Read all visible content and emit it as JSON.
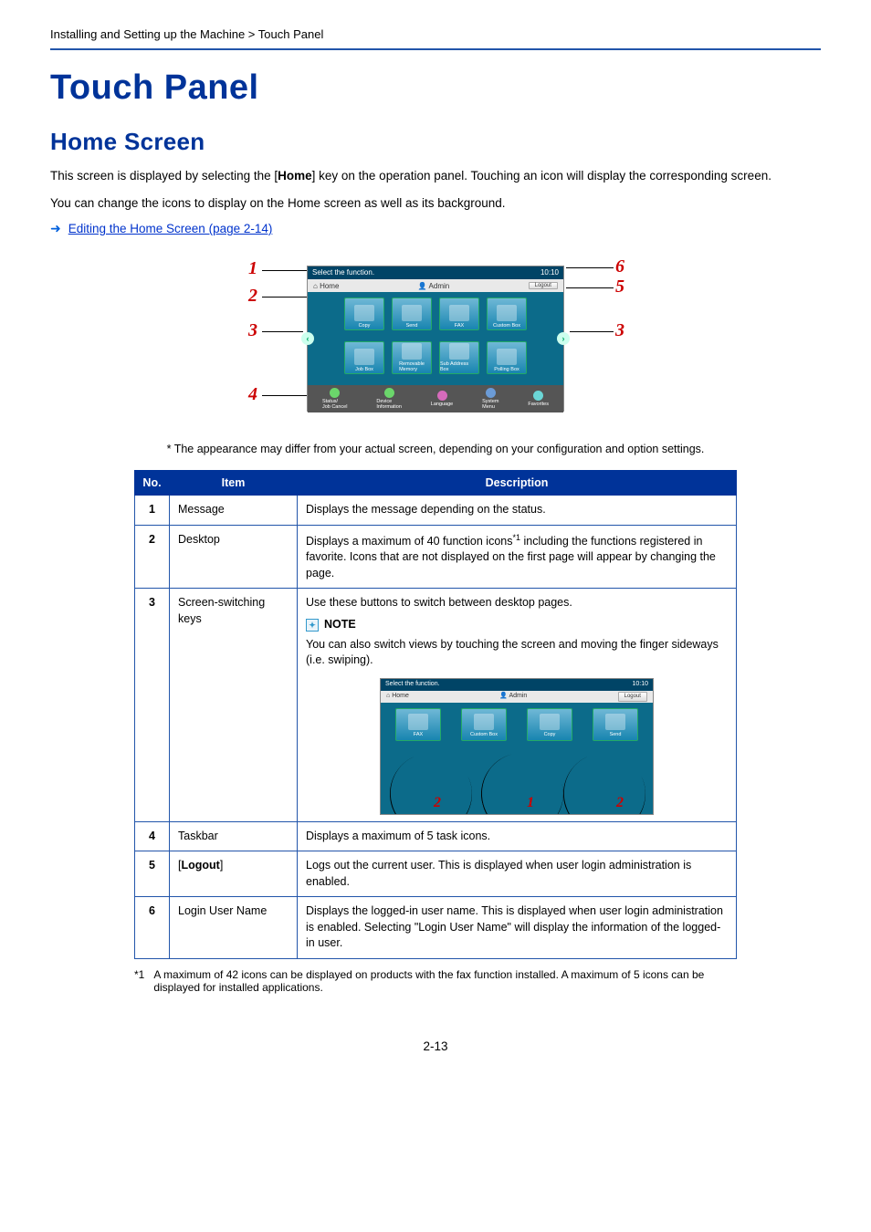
{
  "breadcrumb": "Installing and Setting up the Machine > Touch Panel",
  "title_main": "Touch Panel",
  "title_section": "Home Screen",
  "para1_prefix": "This screen is displayed by selecting the [",
  "para1_bold": "Home",
  "para1_suffix": "] key on the operation panel. Touching an icon will display the corresponding screen.",
  "para2": "You can change the icons to display on the Home screen as well as its background.",
  "link_text": "Editing the Home Screen (page 2-14)",
  "callouts": {
    "c1": "1",
    "c2": "2",
    "c3": "3",
    "c3r": "3",
    "c4": "4",
    "c5": "5",
    "c6": "6"
  },
  "screen": {
    "top_msg": "Select the function.",
    "time": "10:10",
    "home": "Home",
    "admin": "Admin",
    "logout": "Logout",
    "row1": [
      "Copy",
      "Send",
      "FAX",
      "Custom Box"
    ],
    "row2": [
      "Job Box",
      "Removable\nMemory",
      "Sub Address Box",
      "Polling Box"
    ],
    "task": [
      "Status/\nJob Cancel",
      "Device\nInformation",
      "Language",
      "System\nMenu",
      "Favorites"
    ]
  },
  "note_appearance": "*   The appearance may differ from your actual screen, depending on your configuration and option settings.",
  "table": {
    "headers": {
      "no": "No.",
      "item": "Item",
      "desc": "Description"
    },
    "rows": [
      {
        "no": "1",
        "item": "Message",
        "desc": "Displays the message depending on the status."
      },
      {
        "no": "2",
        "item": "Desktop",
        "desc_prefix": "Displays a maximum of 40 function icons",
        "sup": "*1",
        "desc_suffix": " including the functions registered in favorite. Icons that are not displayed on the first page will appear by changing the page."
      },
      {
        "no": "3",
        "item": "Screen-switching keys",
        "desc": "Use these buttons to switch between desktop pages.",
        "note_label": "NOTE",
        "note_body": "You can also switch views by touching the screen and moving the finger sideways (i.e. swiping)."
      },
      {
        "no": "4",
        "item": "Taskbar",
        "desc": "Displays a maximum of 5 task icons."
      },
      {
        "no": "5",
        "item_prefix": "[",
        "item_bold": "Logout",
        "item_suffix": "]",
        "desc": "Logs out the current user. This is displayed when user login administration is enabled."
      },
      {
        "no": "6",
        "item": "Login User Name",
        "desc": "Displays the logged-in user name. This is displayed when user login administration is enabled. Selecting \"Login User Name\" will display the information of the logged-in user."
      }
    ]
  },
  "mini": {
    "top_msg": "Select the function.",
    "time": "10:10",
    "home": "Home",
    "admin": "Admin",
    "logout": "Logout",
    "labels": [
      "FAX",
      "Custom Box",
      "Copy",
      "Send"
    ],
    "n1": "1",
    "n2": "2",
    "n2b": "2"
  },
  "footnote": {
    "label": "*1",
    "text": "A maximum of 42 icons can be displayed on products with the fax function installed. A maximum of 5 icons can be displayed for installed applications."
  },
  "page_num": "2-13"
}
